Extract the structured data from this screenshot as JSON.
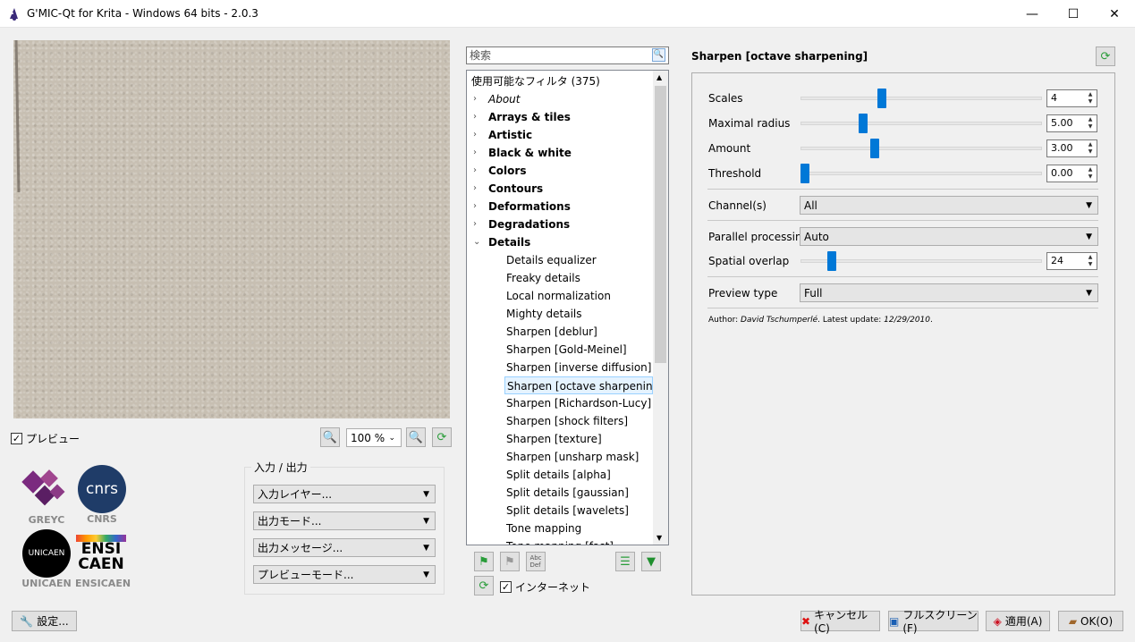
{
  "window": {
    "title": "G'MIC-Qt for Krita - Windows 64 bits - 2.0.3",
    "minimize": "—",
    "maximize": "☐",
    "close": "✕"
  },
  "preview": {
    "checkbox_label": "プレビュー",
    "checked": true,
    "zoom_value": "100 %"
  },
  "logos": [
    "GREYC",
    "CNRS",
    "UNICAEN",
    "ENSICAEN"
  ],
  "logo_text": {
    "cnrs": "cnrs",
    "unicaen": "UNICAEN",
    "ensicaen_top": "ENSI",
    "ensicaen_bottom": "CAEN"
  },
  "io": {
    "group_title": "入力 / 出力",
    "input_layers": "入力レイヤー...",
    "output_mode": "出力モード...",
    "output_messages": "出力メッセージ...",
    "preview_mode": "プレビューモード..."
  },
  "settings_button": "設定...",
  "filters": {
    "search_placeholder": "検索",
    "header": "使用可能なフィルタ (375)",
    "categories": [
      "About",
      "Arrays & tiles",
      "Artistic",
      "Black & white",
      "Colors",
      "Contours",
      "Deformations",
      "Degradations",
      "Details"
    ],
    "details_items": [
      "Details equalizer",
      "Freaky details",
      "Local normalization",
      "Mighty details",
      "Sharpen [deblur]",
      "Sharpen [Gold-Meinel]",
      "Sharpen [inverse diffusion]",
      "Sharpen [octave sharpening]",
      "Sharpen [Richardson-Lucy]",
      "Sharpen [shock filters]",
      "Sharpen [texture]",
      "Sharpen [unsharp mask]",
      "Split details [alpha]",
      "Split details [gaussian]",
      "Split details [wavelets]",
      "Tone mapping",
      "Tone mapping [fast]"
    ],
    "selected": "Sharpen [octave sharpening]",
    "internet_label": "インターネット",
    "internet_checked": true
  },
  "filter_panel": {
    "title": "Sharpen [octave sharpening]",
    "params": [
      {
        "label": "Scales",
        "value": "4",
        "fraction": 0.33
      },
      {
        "label": "Maximal radius",
        "value": "5.00",
        "fraction": 0.25
      },
      {
        "label": "Amount",
        "value": "3.00",
        "fraction": 0.3
      },
      {
        "label": "Threshold",
        "value": "0.00",
        "fraction": 0.0
      }
    ],
    "channels_label": "Channel(s)",
    "channels_value": "All",
    "parallel_label": "Parallel processing",
    "parallel_value": "Auto",
    "overlap_label": "Spatial overlap",
    "overlap_value": "24",
    "overlap_fraction": 0.1,
    "preview_type_label": "Preview type",
    "preview_type_value": "Full",
    "author_prefix": "Author: ",
    "author_name": "David Tschumperlé",
    "update_prefix": ". Latest update: ",
    "update_date": "12/29/2010",
    "update_suffix": "."
  },
  "buttons": {
    "cancel": "キャンセル(C)",
    "fullscreen": "フルスクリーン(F)",
    "apply": "適用(A)",
    "ok": "OK(O)"
  }
}
